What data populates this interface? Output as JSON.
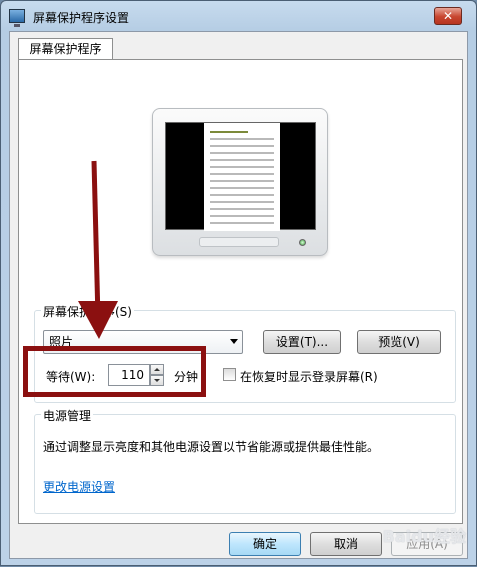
{
  "window": {
    "title": "屏幕保护程序设置",
    "close_label": "✕"
  },
  "tabs": [
    {
      "label": "屏幕保护程序"
    }
  ],
  "screensaver": {
    "group_label": "屏幕保护程序(S)",
    "selected": "照片",
    "settings_button": "设置(T)...",
    "preview_button": "预览(V)",
    "wait_label": "等待(W):",
    "wait_value": "110",
    "wait_unit": "分钟",
    "resume_label": "在恢复时显示登录屏幕(R)",
    "resume_checked": false
  },
  "power": {
    "group_label": "电源管理",
    "description": "通过调整显示亮度和其他电源设置以节省能源或提供最佳性能。",
    "link": "更改电源设置"
  },
  "footer": {
    "ok": "确定",
    "cancel": "取消",
    "apply": "应用(A)"
  },
  "annotation": {
    "color": "#8b1010"
  },
  "watermark": "Baidu经验"
}
